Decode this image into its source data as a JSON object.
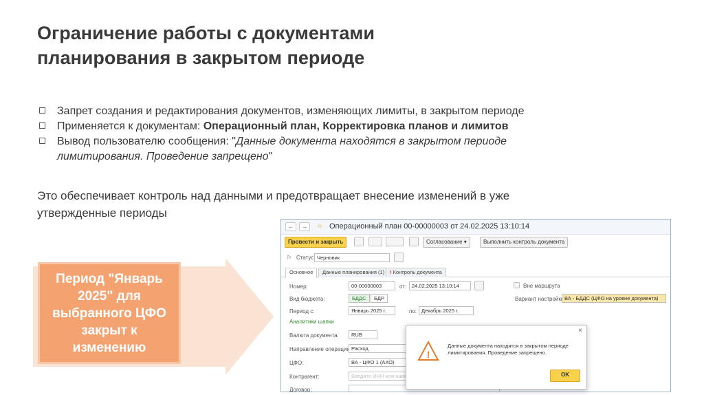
{
  "slide": {
    "title_line1": "Ограничение работы с документами",
    "title_line2": "планирования в закрытом периоде",
    "bullets": [
      {
        "text": "Запрет создания и редактирования документов, изменяющих лимиты, в закрытом периоде"
      },
      {
        "prefix": "Применяется к документам: ",
        "bold": "Операционный план, Корректировка планов и лимитов"
      },
      {
        "prefix": "Вывод пользователю сообщения: \"",
        "italic_line1": "Данные документа находятся в закрытом периоде",
        "italic_line2": "лимитирования. Проведение запрещено",
        "suffix": "\""
      }
    ],
    "summary_line1": "Это обеспечивает контроль над данными и предотвращает внесение изменений в уже",
    "summary_line2": "утвержденные периоды",
    "callout": "Период \"Январь 2025\" для выбранного ЦФО закрыт к изменению",
    "colors": {
      "callout_bg": "#f4a26f",
      "callout_border": "#f7c8a8",
      "arrow": "#fbe3d3",
      "primary_button": "#f8d24b"
    }
  },
  "window": {
    "back_icon": "arrow-left-icon",
    "forward_icon": "arrow-right-icon",
    "title": "Операционный план 00-00000003 от 24.02.2025 13:10:14",
    "toolbar": {
      "post_close": "Провести и закрыть",
      "approval": "Согласование",
      "check": "Выполнить контроль документа"
    },
    "status_label": "Статус:",
    "status_value": "Черновик",
    "tabs": [
      "Основное",
      "Данные планирования (1)",
      "Контроль документа"
    ],
    "number_label": "Номер:",
    "number_value": "00-00000003",
    "date_label": "от:",
    "date_value": "24.02.2025 13:10:14",
    "route_label": "Вне маршрута",
    "budget_type_label": "Вид бюджета:",
    "budget_types": [
      "БДДС",
      "БДР"
    ],
    "settings_label": "Вариант настройки:",
    "settings_value": "ВА - БДДС (ЦФО на уровне документа)",
    "period_from_label": "Период с:",
    "period_from_value": "Январь 2025 г.",
    "period_to_label": "по:",
    "period_to_value": "Декабрь 2025 г.",
    "header_analytics": "Аналитики шапки",
    "currency_label": "Валюта документа:",
    "currency_value": "RUB",
    "direction_label": "Направление операции:",
    "direction_value": "Расход",
    "cfo_label": "ЦФО:",
    "cfo_value": "ВА - ЦФО 1 (АХО)",
    "counterparty_label": "Контрагент:",
    "counterparty_placeholder": "Введите ИНН или наиме",
    "contract_label": "Договор:"
  },
  "dialog": {
    "message": "Данные документа находятся в закрытом периоде лимитирования. Проведение запрещено.",
    "ok": "OK",
    "close_icon": "close-icon",
    "warning_icon": "warning-icon"
  }
}
